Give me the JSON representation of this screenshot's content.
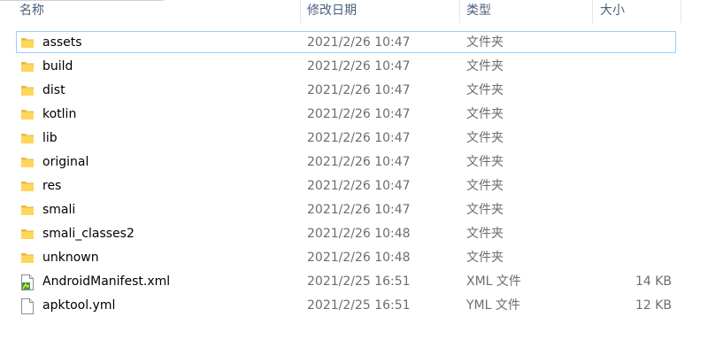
{
  "columns": {
    "name": "名称",
    "date": "修改日期",
    "type": "类型",
    "size": "大小"
  },
  "files": [
    {
      "name": "assets",
      "date": "2021/2/26 10:47",
      "type": "文件夹",
      "size": "",
      "icon": "folder-icon",
      "selected": true
    },
    {
      "name": "build",
      "date": "2021/2/26 10:47",
      "type": "文件夹",
      "size": "",
      "icon": "folder-icon"
    },
    {
      "name": "dist",
      "date": "2021/2/26 10:47",
      "type": "文件夹",
      "size": "",
      "icon": "folder-icon"
    },
    {
      "name": "kotlin",
      "date": "2021/2/26 10:47",
      "type": "文件夹",
      "size": "",
      "icon": "folder-icon"
    },
    {
      "name": "lib",
      "date": "2021/2/26 10:47",
      "type": "文件夹",
      "size": "",
      "icon": "folder-icon"
    },
    {
      "name": "original",
      "date": "2021/2/26 10:47",
      "type": "文件夹",
      "size": "",
      "icon": "folder-icon"
    },
    {
      "name": "res",
      "date": "2021/2/26 10:47",
      "type": "文件夹",
      "size": "",
      "icon": "folder-icon"
    },
    {
      "name": "smali",
      "date": "2021/2/26 10:47",
      "type": "文件夹",
      "size": "",
      "icon": "folder-icon"
    },
    {
      "name": "smali_classes2",
      "date": "2021/2/26 10:48",
      "type": "文件夹",
      "size": "",
      "icon": "folder-icon"
    },
    {
      "name": "unknown",
      "date": "2021/2/26 10:48",
      "type": "文件夹",
      "size": "",
      "icon": "folder-icon"
    },
    {
      "name": "AndroidManifest.xml",
      "date": "2021/2/25 16:51",
      "type": "XML 文件",
      "size": "14 KB",
      "icon": "xml-file-icon"
    },
    {
      "name": "apktool.yml",
      "date": "2021/2/25 16:51",
      "type": "YML 文件",
      "size": "12 KB",
      "icon": "text-file-icon"
    }
  ]
}
